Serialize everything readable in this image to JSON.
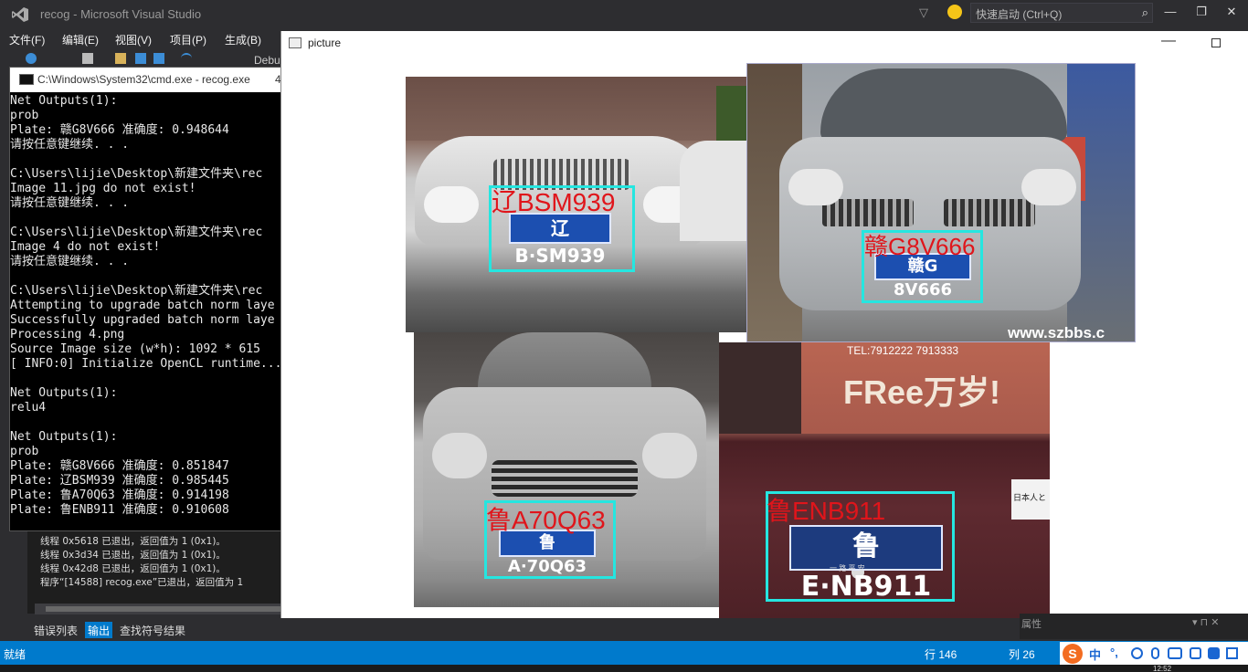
{
  "vs": {
    "title": "recog - Microsoft Visual Studio",
    "quick_launch": "快速启动 (Ctrl+Q)",
    "menu": [
      "文件(F)",
      "编辑(E)",
      "视图(V)",
      "项目(P)",
      "生成(B)"
    ],
    "toolbar_debug": "Debu"
  },
  "cmd": {
    "title": "C:\\Windows\\System32\\cmd.exe - recog.exe",
    "title_suffix": "4",
    "lines": [
      "Net Outputs(1):",
      "prob",
      "Plate: 赣G8V666 准确度: 0.948644",
      "请按任意键继续. . .",
      "",
      "C:\\Users\\lijie\\Desktop\\新建文件夹\\rec",
      "Image 11.jpg do not exist!",
      "请按任意键继续. . .",
      "",
      "C:\\Users\\lijie\\Desktop\\新建文件夹\\rec",
      "Image 4 do not exist!",
      "请按任意键继续. . .",
      "",
      "C:\\Users\\lijie\\Desktop\\新建文件夹\\rec",
      "Attempting to upgrade batch norm laye",
      "Successfully upgraded batch norm laye",
      "Processing 4.png",
      "Source Image size (w*h): 1092 * 615",
      "[ INFO:0] Initialize OpenCL runtime...",
      "",
      "Net Outputs(1):",
      "relu4",
      "",
      "Net Outputs(1):",
      "prob",
      "Plate: 赣G8V666 准确度: 0.851847",
      "Plate: 辽BSM939 准确度: 0.985445",
      "Plate: 鲁A70Q63 准确度: 0.914198",
      "Plate: 鲁ENB911 准确度: 0.910608"
    ]
  },
  "output": {
    "lines": [
      "线程 0x5618 已退出，返回值为 1 (0x1)。",
      "线程 0x3d34 已退出，返回值为 1 (0x1)。",
      "线程 0x42d8 已退出，返回值为 1 (0x1)。",
      "程序“[14588] recog.exe”已退出，返回值为 1"
    ]
  },
  "bottom_tabs": [
    "错误列表",
    "输出",
    "查找符号结果"
  ],
  "picture": {
    "title": "picture",
    "cars": [
      {
        "label": "辽BSM939",
        "plate": "辽B·SM939"
      },
      {
        "label": "赣G8V666",
        "plate": "赣G 8V666",
        "watermark": "www.szbbs.c"
      },
      {
        "label": "鲁A70Q63",
        "plate": "鲁A·70Q63"
      },
      {
        "label": "鲁ENB911",
        "plate": "鲁E·NB911",
        "banner": "FRee万岁!",
        "banner_top": "TEL:7912222  7913333",
        "plate_sub": "一 路 平 安",
        "sticker": "日本人と"
      }
    ]
  },
  "properties_label": "属性",
  "status": {
    "text": "就绪",
    "line": "行 146",
    "col": "列 26"
  },
  "ime": {
    "logo": "S",
    "lang": "中",
    "punct": "°,"
  },
  "taskbar_time": "12:52"
}
